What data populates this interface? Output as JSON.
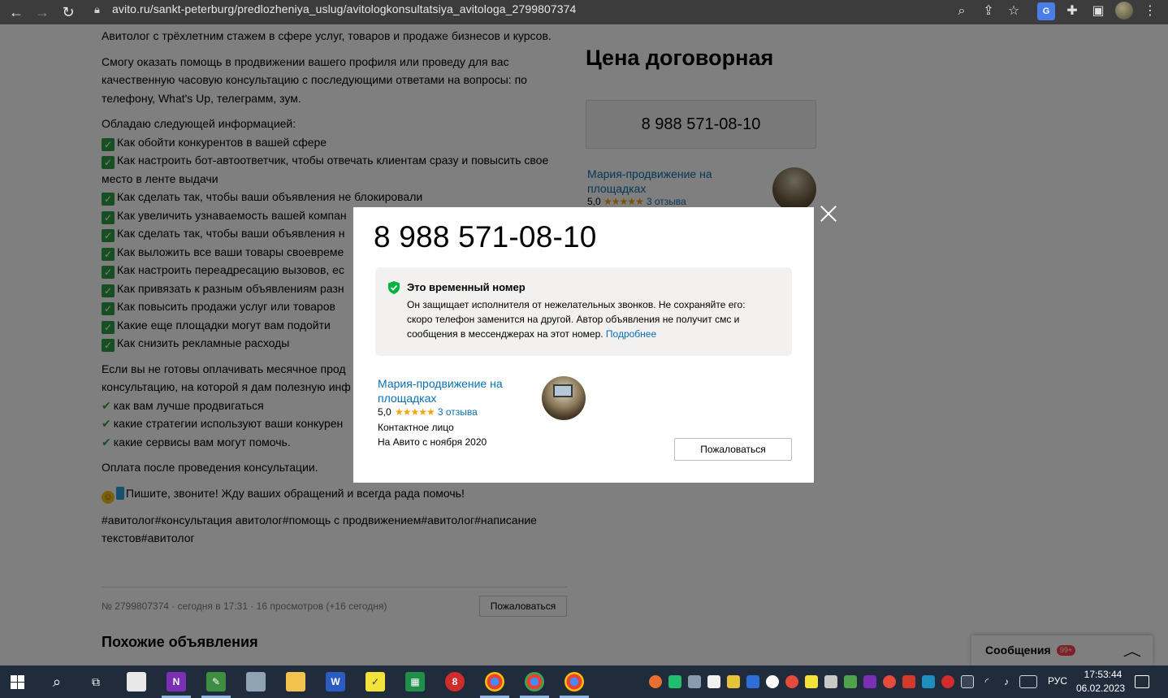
{
  "browser": {
    "url": "avito.ru/sankt-peterburg/predlozheniya_uslug/avitologkonsultatsiya_avitologa_2799807374",
    "back_icon": "←",
    "forward_icon": "→",
    "reload_icon": "↻"
  },
  "article": {
    "intro": "Авитолог с трёхлетним стажем в сфере услуг, товаров и продаже бизнесов и курсов.",
    "offer_lines": [
      "Смогу оказать помощь в продвижении вашего профиля или проведу для вас",
      "качественную часовую консультацию с последующими ответами на вопросы: по",
      "телефону, What's Up, телеграмм, зум."
    ],
    "info_heading": "Обладаю следующей информацией:",
    "checklist": [
      "Как обойти конкурентов в вашей сфере",
      "Как настроить бот-автоответчик, чтобы отвечать клиентам сразу и повысить свое",
      "место в ленте выдачи",
      "Как сделать так, чтобы ваши объявления не блокировали",
      "Как увеличить узнаваемость вашей компан",
      "Как сделать так, чтобы ваши объявления н",
      "Как выложить все ваши товары своевреме",
      "Как настроить переадресацию вызовов, ес",
      "Как привязать к разным объявлениям разн",
      "Как повысить продажи услуг или товаров",
      "Какие еще площадки могут вам подойти",
      "Как снизить рекламные расходы"
    ],
    "offer2_lines": [
      "Если вы не готовы оплачивать месячное прод",
      "консультацию, на которой я дам полезную инф"
    ],
    "ticks": [
      "как вам лучше продвигаться",
      "какие стратегии используют ваши конкурен",
      "какие сервисы вам могут помочь."
    ],
    "payment": "Оплата после проведения консультации.",
    "cta": "Пишите, звоните! Жду ваших обращений и всегда рада помочь!",
    "tags_lines": [
      "#авитолог#консультация авитолог#помощь с продвижением#авитолог#написание",
      "текстов#авитолог"
    ]
  },
  "meta": {
    "info": "№ 2799807374 · сегодня в 17:31 · 16 просмотров (+16 сегодня)",
    "report_label": "Пожаловаться"
  },
  "similar_title": "Похожие объявления",
  "sidebar": {
    "price": "Цена договорная",
    "phone": "8 988 571-08-10",
    "seller_name": "Мария-продвижение на площадках",
    "rating": "5,0",
    "reviews": "3 отзыва"
  },
  "messages": {
    "label": "Сообщения",
    "badge": "99+"
  },
  "modal": {
    "phone": "8 988 571-08-10",
    "notice_title": "Это временный номер",
    "notice_text": "Он защищает исполнителя от нежелательных звонков. Не сохраняйте его: скоро телефон заменится на другой. Автор объявления не получит смс и сообщения в мессенджерах на этот номер.",
    "notice_link": "Подробнее",
    "seller_name": "Мария-продвижение на площадках",
    "rating": "5,0",
    "reviews": "3 отзыва",
    "role": "Контактное лицо",
    "since": "На Авито с ноября 2020",
    "report_label": "Пожаловаться"
  },
  "taskbar": {
    "lang": "РУС",
    "time": "17:53:44",
    "date": "06.02.2023"
  }
}
